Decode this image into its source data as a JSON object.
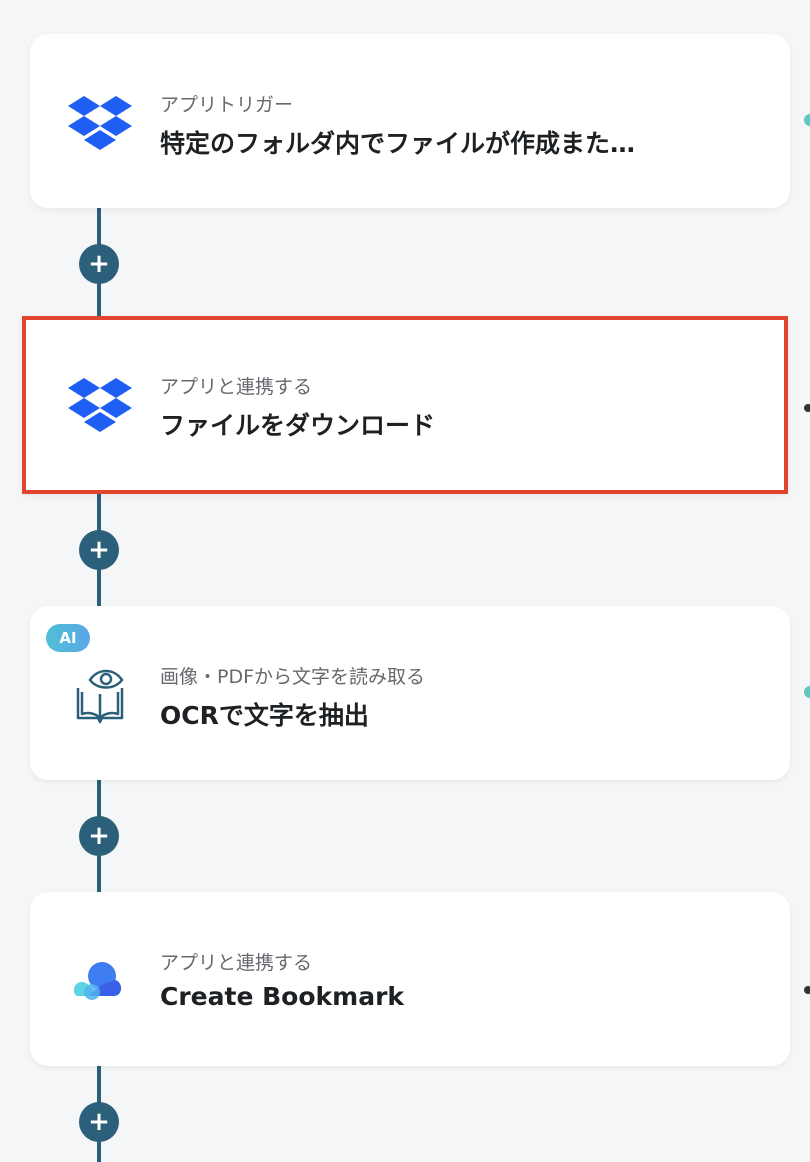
{
  "colors": {
    "connector": "#2b5f7a",
    "selected_border": "#e2452f",
    "dropbox_blue": "#1f5ef5",
    "ai_badge": "#4fbfd6"
  },
  "add_button": {
    "icon": "plus-icon",
    "symbol": "+"
  },
  "steps": [
    {
      "icon": "dropbox-icon",
      "subtitle": "アプリトリガー",
      "title": "特定のフォルダ内でファイルが作成また…",
      "selected": false
    },
    {
      "icon": "dropbox-icon",
      "subtitle": "アプリと連携する",
      "title": "ファイルをダウンロード",
      "selected": true
    },
    {
      "icon": "ocr-book-eye-icon",
      "badge": "AI",
      "subtitle": "画像・PDFから文字を読み取る",
      "title": "OCRで文字を抽出",
      "selected": false
    },
    {
      "icon": "raindrop-cloud-icon",
      "subtitle": "アプリと連携する",
      "title": "Create Bookmark",
      "selected": false
    }
  ]
}
